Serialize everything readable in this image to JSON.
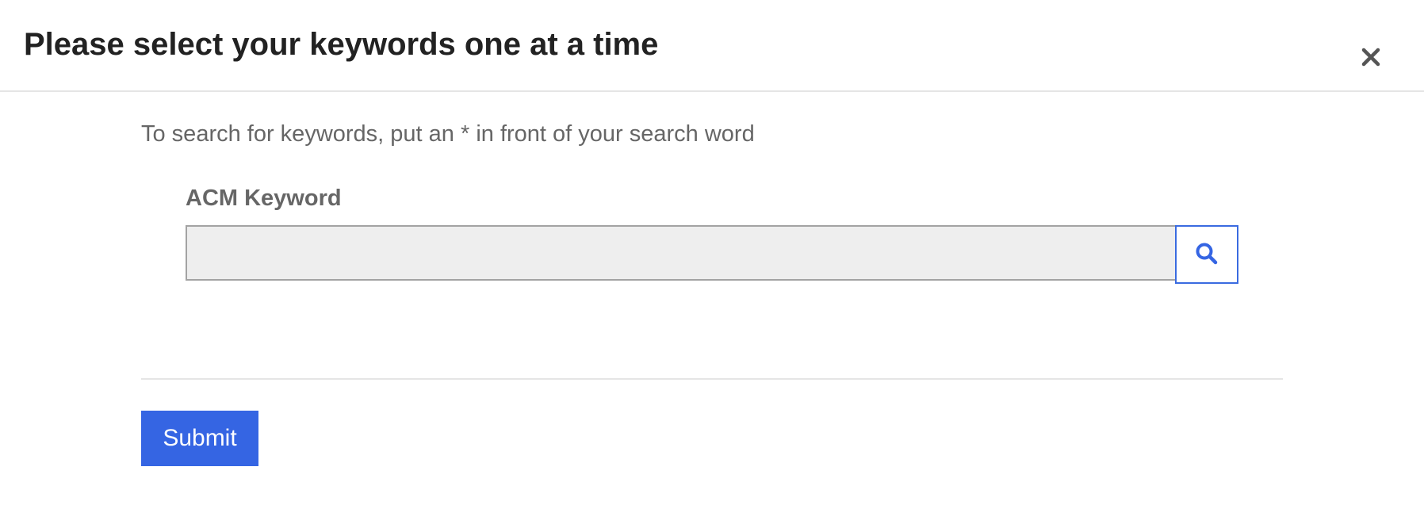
{
  "modal": {
    "title": "Please select your keywords one at a time",
    "close_icon": "close-icon"
  },
  "body": {
    "hint": "To search for keywords, put an * in front of your search word",
    "keyword_field": {
      "label": "ACM Keyword",
      "value": "",
      "placeholder": ""
    },
    "search_icon": "search-icon"
  },
  "footer": {
    "submit_label": "Submit"
  },
  "colors": {
    "accent": "#3565e3",
    "input_background": "#eeeeee",
    "muted_text": "#666666"
  }
}
